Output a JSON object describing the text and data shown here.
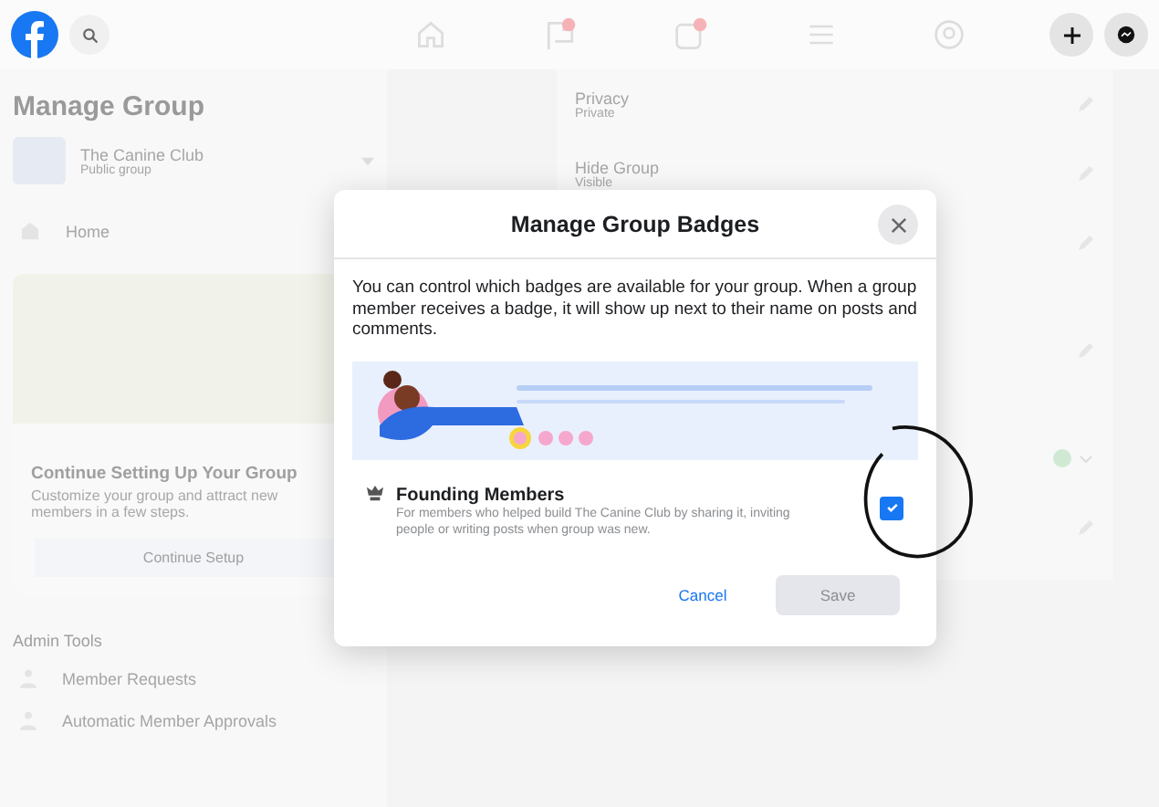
{
  "sidebar": {
    "title": "Manage Group",
    "group": {
      "name": "The Canine Club",
      "privacy": "Public group"
    },
    "nav": [
      {
        "label": "Home"
      }
    ],
    "setup_card": {
      "title": "Continue Setting Up Your Group",
      "description": "Customize your group and attract new members in a few steps.",
      "button": "Continue Setup"
    },
    "admin_tools": {
      "title": "Admin Tools",
      "items": [
        {
          "label": "Member Requests"
        },
        {
          "label": "Automatic Member Approvals"
        }
      ]
    }
  },
  "settings": [
    {
      "label": "Privacy",
      "value": "Private"
    },
    {
      "label": "Hide Group",
      "value": "Visible"
    }
  ],
  "dialog": {
    "title": "Manage Group Badges",
    "description": "You can control which badges are available for your group. When a group member receives a badge, it will show up next to their name on posts and comments.",
    "badges": [
      {
        "title": "Founding Members",
        "description": "For members who helped build The Canine Club by sharing it, inviting people or writing posts when group was new.",
        "checked": true
      }
    ],
    "buttons": [
      {
        "label": "Cancel",
        "kind": "link",
        "disabled": false
      },
      {
        "label": "Save",
        "kind": "primary",
        "disabled": true
      }
    ]
  }
}
